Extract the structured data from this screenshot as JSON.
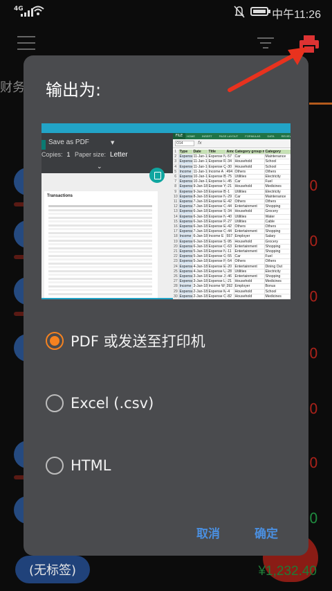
{
  "status_bar": {
    "network": "4G",
    "time": "中午11:26"
  },
  "background": {
    "tab_label": "财务",
    "amount_fragment": "0",
    "tag_chip": "(无标签)",
    "total": "¥1,232.40"
  },
  "dialog": {
    "title": "输出为:",
    "options": [
      {
        "label": "PDF 或发送至打印机",
        "checked": true
      },
      {
        "label": "Excel (.csv)",
        "checked": false
      },
      {
        "label": "HTML",
        "checked": false
      }
    ],
    "cancel_label": "取消",
    "confirm_label": "确定"
  },
  "preview": {
    "print_dialog": {
      "destination": "Save as PDF",
      "copies_label": "Copies:",
      "copies_value": "1",
      "paper_label": "Paper size:",
      "paper_value": "Letter",
      "document_title": "Transactions"
    },
    "spreadsheet": {
      "ribbon_tabs": [
        "FILE",
        "HOME",
        "INSERT",
        "PAGE LAYOUT",
        "FORMULAS",
        "DATA",
        "REVIEW"
      ],
      "cell_ref": "O14",
      "fx": "fx",
      "headers": [
        "Type",
        "Date",
        "Title",
        "Amount",
        "Category group name",
        "Category"
      ],
      "rows": [
        [
          "Expense",
          "11-Jan-18",
          "Expense N",
          "-57",
          "Car",
          "Maintenance"
        ],
        [
          "Expense",
          "11-Jan-18",
          "Expense R",
          "-34",
          "Household",
          "School"
        ],
        [
          "Expense",
          "11-Jan-18",
          "Expense Q",
          "-30",
          "Household",
          "School"
        ],
        [
          "Income",
          "11-Jan-18",
          "Income A",
          "494",
          "Others",
          "Others"
        ],
        [
          "Expense",
          "10-Jan-18",
          "Expense B",
          "-75",
          "Utilities",
          "Electricity"
        ],
        [
          "Expense",
          "10-Jan-18",
          "Expense H",
          "-45",
          "Car",
          "Fuel"
        ],
        [
          "Expense",
          "9-Jan-18",
          "Expense Y",
          "-21",
          "Household",
          "Medicines"
        ],
        [
          "Expense",
          "9-Jan-18",
          "Expense B",
          "-1",
          "Utilities",
          "Electricity"
        ],
        [
          "Expense",
          "8-Jan-18",
          "Expense N",
          "-29",
          "Car",
          "Maintenance"
        ],
        [
          "Expense",
          "7-Jan-18",
          "Expense E",
          "-42",
          "Others",
          "Others"
        ],
        [
          "Expense",
          "7-Jan-18",
          "Expense O",
          "-44",
          "Entertainment",
          "Shopping"
        ],
        [
          "Expense",
          "6-Jan-18",
          "Expense S",
          "-34",
          "Household",
          "Grocery"
        ],
        [
          "Expense",
          "6-Jan-18",
          "Expense N",
          "-40",
          "Utilities",
          "Water"
        ],
        [
          "Expense",
          "6-Jan-18",
          "Expense P",
          "-27",
          "Utilities",
          "Cable"
        ],
        [
          "Expense",
          "6-Jan-18",
          "Expense E",
          "-42",
          "Others",
          "Others"
        ],
        [
          "Expense",
          "7-Jan-18",
          "Expense O",
          "-44",
          "Entertainment",
          "Shopping"
        ],
        [
          "Income",
          "6-Jan-18",
          "Income E",
          "557",
          "Employer",
          "Salary"
        ],
        [
          "Expense",
          "6-Jan-18",
          "Expense S",
          "-95",
          "Household",
          "Grocery"
        ],
        [
          "Expense",
          "6-Jan-18",
          "Expense C",
          "-63",
          "Entertainment",
          "Shopping"
        ],
        [
          "Expense",
          "5-Jan-18",
          "Expense N",
          "-11",
          "Entertainment",
          "Shopping"
        ],
        [
          "Expense",
          "5-Jan-18",
          "Expense G",
          "-55",
          "Car",
          "Fuel"
        ],
        [
          "Expense",
          "5-Jan-18",
          "Expense F",
          "-54",
          "Others",
          "Others"
        ],
        [
          "Expense",
          "4-Jan-18",
          "Expense E",
          "-20",
          "Entertainment",
          "Dining Out"
        ],
        [
          "Expense",
          "4-Jan-18",
          "Expense U",
          "-28",
          "Utilities",
          "Electricity"
        ],
        [
          "Expense",
          "3-Jan-18",
          "Expense J",
          "-46",
          "Entertainment",
          "Shopping"
        ],
        [
          "Expense",
          "3-Jan-18",
          "Expense L",
          "-21",
          "Household",
          "Medicines"
        ],
        [
          "Income",
          "3-Jan-18",
          "Income W",
          "392",
          "Employer",
          "Bonus"
        ],
        [
          "Expense",
          "2-Jan-18",
          "Expense M",
          "-4",
          "Household",
          "School"
        ],
        [
          "Expense",
          "2-Jan-18",
          "Expense C",
          "-82",
          "Household",
          "Medicines"
        ],
        [
          "Expense",
          "2-Jan-18",
          "Expense N",
          "-30",
          "Car",
          "Maintenance"
        ],
        [
          "Expense",
          "2-Jan-18",
          "Expense K",
          "-43",
          "Car",
          "Maintenance"
        ],
        [
          "Expense",
          "1-Jan-18",
          "Expense N",
          "-86",
          "Household",
          "Clothing"
        ],
        [
          "Expense",
          "1-Jan-18",
          "Expense F",
          "-18",
          "Car",
          "Maintenance"
        ],
        [
          "Expense",
          "1-Jan-18",
          "Expense S",
          "-65",
          "Utilities",
          "Water"
        ],
        [
          "Expense",
          "1-Jan-18",
          "Expense H",
          "-69",
          "Household",
          "Medicines"
        ],
        [
          "Expense",
          "1-Jan-18",
          "Expense U",
          "-10",
          "Utilities",
          "Water"
        ]
      ]
    }
  }
}
